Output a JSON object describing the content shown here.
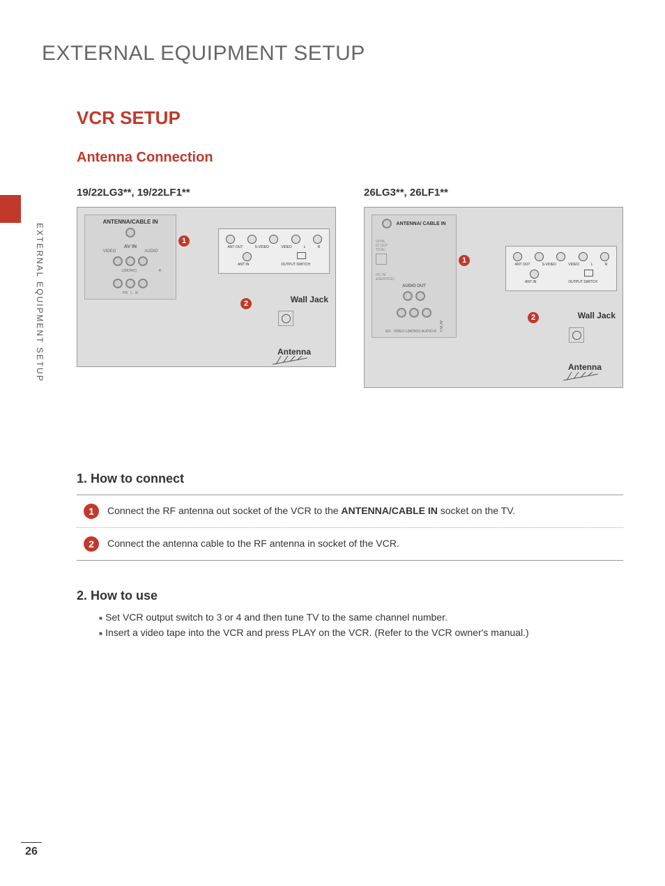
{
  "page_number": "26",
  "side_label": "EXTERNAL EQUIPMENT SETUP",
  "main_title": "EXTERNAL EQUIPMENT SETUP",
  "vcr_title": "VCR SETUP",
  "sub_title": "Antenna Connection",
  "models": {
    "left": "19/22LG3**, 19/22LF1**",
    "right": "26LG3**, 26LF1**"
  },
  "diagram_labels": {
    "antenna_cable_in": "ANTENNA/CABLE IN",
    "av_in": "AV IN",
    "video": "VIDEO",
    "audio": "AUDIO",
    "l_mono": "L(MONO)",
    "r": "R",
    "pr": "PR",
    "ant_out": "ANT OUT",
    "ant_in": "ANT IN",
    "s_video": "S-VIDEO",
    "output_switch": "OUTPUT SWITCH",
    "wall_jack": "Wall Jack",
    "antenna": "Antenna",
    "audio_out": "AUDIO OUT",
    "av_in_1": "AV IN 1",
    "antenna_cable_in_stacked": "ANTENNA/ CABLE IN"
  },
  "callouts": {
    "one": "1",
    "two": "2"
  },
  "how_to_connect": {
    "heading": "1. How to connect",
    "step1_pre": "Connect the RF antenna out socket of the VCR to the ",
    "step1_bold": "ANTENNA/CABLE IN",
    "step1_post": " socket on the TV.",
    "step2": "Connect the antenna cable to the RF antenna in socket of the VCR."
  },
  "how_to_use": {
    "heading": "2. How to use",
    "b1": "Set VCR output switch to 3 or 4 and then tune TV to the same channel number.",
    "b2": "Insert a video tape into the VCR and press PLAY on the VCR. (Refer to the VCR owner's manual.)"
  }
}
